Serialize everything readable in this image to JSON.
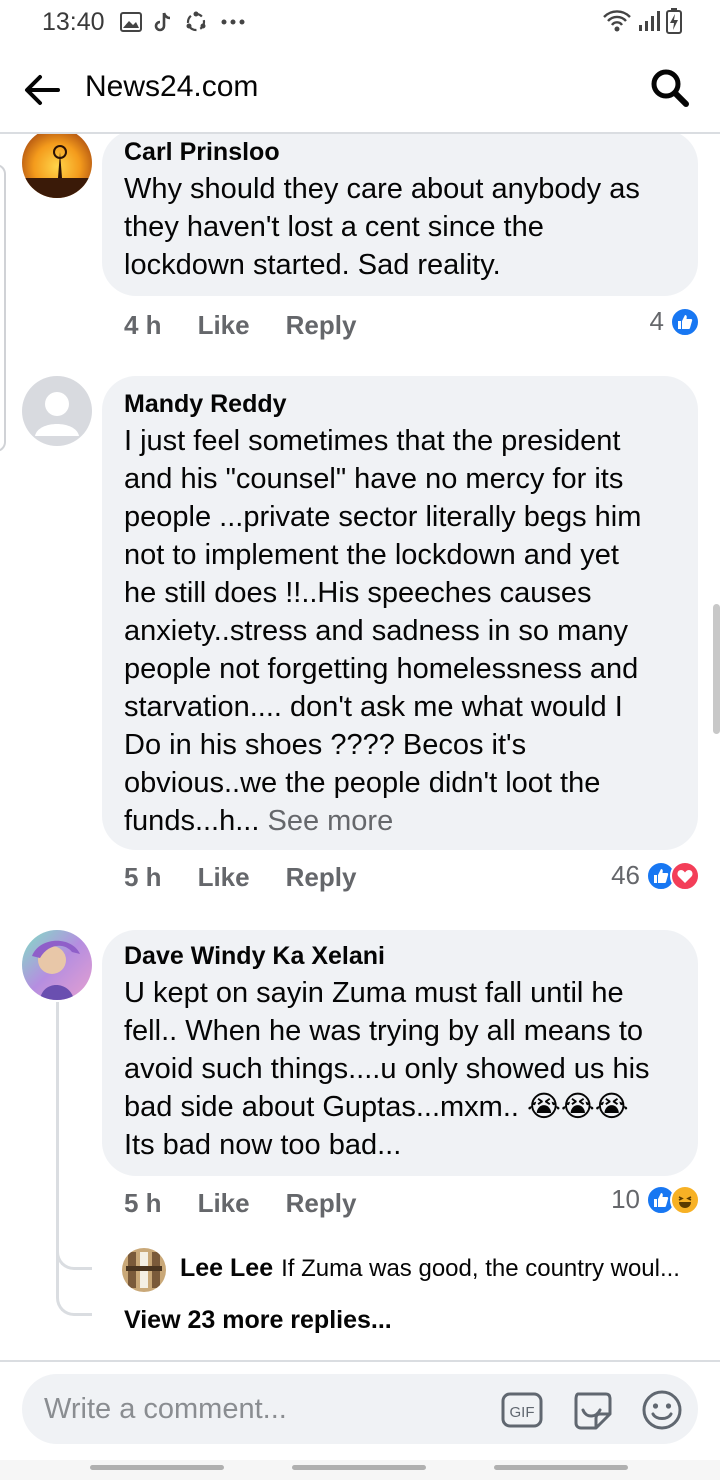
{
  "status_bar": {
    "time": "13:40"
  },
  "header": {
    "title": "News24.com"
  },
  "comments": [
    {
      "author": "Carl Prinsloo",
      "lines": [
        "Why should they care about anybody as",
        "they haven't lost a cent since the",
        "lockdown started. Sad reality."
      ],
      "time": "4 h",
      "like_label": "Like",
      "reply_label": "Reply",
      "reaction_count": "4"
    },
    {
      "author": "Mandy Reddy",
      "lines": [
        "I just feel sometimes that the president",
        "and his \"counsel\" have no mercy for its",
        "people ...private sector literally begs him",
        "not to implement the lockdown and yet",
        "he still does !!..His speeches causes",
        "anxiety..stress and sadness in so many",
        "people not forgetting homelessness and",
        "starvation.... don't ask me what would I",
        "Do in his shoes ???? Becos it's",
        "obvious..we the people didn't loot the"
      ],
      "last_line": "funds...h...",
      "see_more": "See more",
      "time": "5 h",
      "like_label": "Like",
      "reply_label": "Reply",
      "reaction_count": "46"
    },
    {
      "author": "Dave Windy Ka Xelani",
      "lines": [
        "U kept on sayin Zuma must fall until he",
        "fell.. When he was trying by all means to",
        "avoid such things....u only showed us his",
        "bad side about Guptas...mxm.."
      ],
      "emoji": "😭😭😭",
      "last_line": "Its bad now too bad...",
      "time": "5 h",
      "like_label": "Like",
      "reply_label": "Reply",
      "reaction_count": "10",
      "reply_preview": {
        "author": "Lee Lee",
        "text": "If Zuma was good, the country woul..."
      },
      "view_more": "View 23 more replies..."
    }
  ],
  "composer": {
    "placeholder": "Write a comment...",
    "gif_label": "GIF"
  },
  "colors": {
    "like_blue": "#1877f2",
    "love_red": "#f33e58",
    "haha_yellow": "#f7b125",
    "bubble": "#f0f2f5",
    "muted": "#65676b"
  }
}
